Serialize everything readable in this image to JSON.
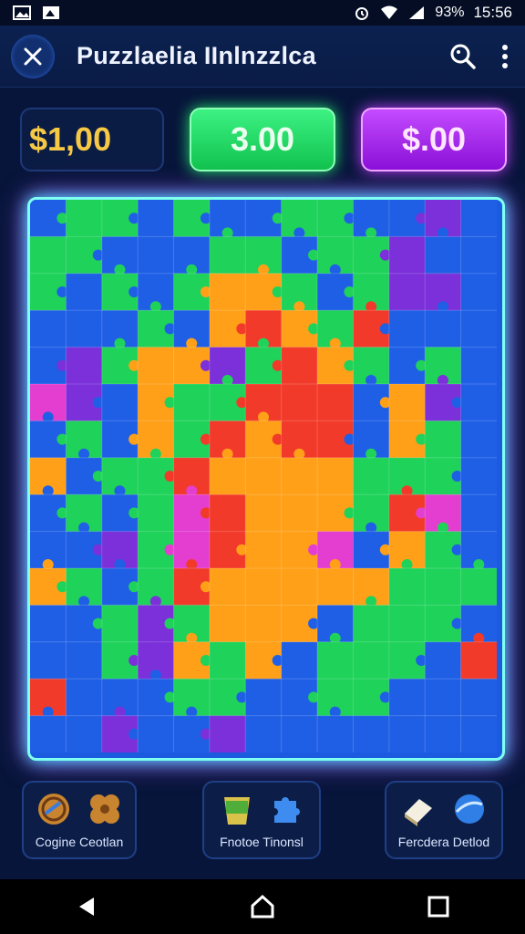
{
  "status": {
    "battery": "93%",
    "time": "15:56"
  },
  "app": {
    "title": "Puzzlaelia IInlnzzlca"
  },
  "scores": {
    "left": "$1,00",
    "middle": "3.00",
    "right": "$.00"
  },
  "tools": [
    {
      "label": "Cogine Ceotlan",
      "icons": [
        "cookie-icon",
        "waffle-icon"
      ]
    },
    {
      "label": "Fnotoe Tinonsl",
      "icons": [
        "bucket-icon",
        "puzzle-piece-icon"
      ]
    },
    {
      "label": "Fercdera Detlod",
      "icons": [
        "eraser-icon",
        "globe-icon"
      ]
    }
  ],
  "board": {
    "columns": 13,
    "rows": 15,
    "colors": {
      "blue": "#1f5fe6",
      "green": "#1fd25a",
      "purple": "#7b30d9",
      "orange": "#ffa018",
      "red": "#f23a2a",
      "magenta": "#e43ed0"
    }
  },
  "colors": {
    "accent_green": "#22e36b",
    "accent_purple": "#c13cff",
    "gold": "#f6c945"
  }
}
